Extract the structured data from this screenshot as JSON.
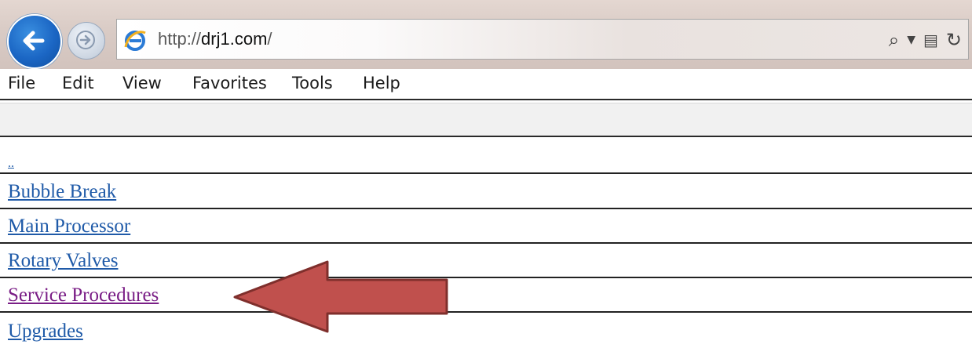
{
  "browser": {
    "url_prefix": "http://",
    "url_domain": "drj1.com",
    "url_suffix": "/"
  },
  "menu": {
    "items": [
      "File",
      "Edit",
      "View",
      "Favorites",
      "Tools",
      "Help"
    ]
  },
  "page": {
    "links": [
      {
        "label": "..",
        "visited": false
      },
      {
        "label": "Bubble Break",
        "visited": false
      },
      {
        "label": "Main Processor",
        "visited": false
      },
      {
        "label": "Rotary Valves",
        "visited": false
      },
      {
        "label": "Service Procedures",
        "visited": true
      },
      {
        "label": "Upgrades",
        "visited": false
      }
    ]
  },
  "colors": {
    "link": "#1f5aa8",
    "visited_link": "#7a1e86",
    "arrow_fill": "#c0504d",
    "arrow_stroke": "#7f2f2c"
  }
}
